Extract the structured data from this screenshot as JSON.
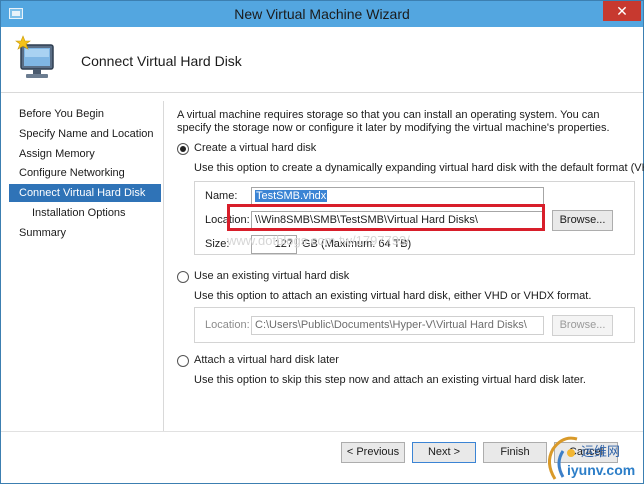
{
  "window": {
    "title": "New Virtual Machine Wizard",
    "close_glyph": "✕"
  },
  "header": {
    "title": "Connect Virtual Hard Disk",
    "icon": "monitor-with-star-icon"
  },
  "sidebar": {
    "items": [
      {
        "label": "Before You Begin",
        "active": false
      },
      {
        "label": "Specify Name and Location",
        "active": false
      },
      {
        "label": "Assign Memory",
        "active": false
      },
      {
        "label": "Configure Networking",
        "active": false
      },
      {
        "label": "Connect Virtual Hard Disk",
        "active": true
      },
      {
        "label": "Installation Options",
        "active": false
      },
      {
        "label": "Summary",
        "active": false
      }
    ]
  },
  "main": {
    "description": "A virtual machine requires storage so that you can install an operating system. You can specify the storage now or configure it later by modifying the virtual machine's properties.",
    "create": {
      "label": "Create a virtual hard disk",
      "checked": true,
      "help": "Use this option to create a dynamically expanding virtual hard disk with the default format (VHDX).",
      "name_label": "Name:",
      "name_value": "TestSMB.vhdx",
      "location_label": "Location:",
      "location_value": "\\\\Win8SMB\\SMB\\TestSMB\\Virtual Hard Disks\\",
      "browse_label": "Browse...",
      "size_label": "Size:",
      "size_value": "127",
      "size_unit": "GB (Maximum: 64 TB)"
    },
    "existing": {
      "label": "Use an existing virtual hard disk",
      "checked": false,
      "help": "Use this option to attach an existing virtual hard disk, either VHD or VHDX format.",
      "location_label": "Location:",
      "location_value": "C:\\Users\\Public\\Documents\\Hyper-V\\Virtual Hard Disks\\",
      "browse_label": "Browse..."
    },
    "later": {
      "label": "Attach a virtual hard disk later",
      "checked": false,
      "help": "Use this option to skip this step now and attach an existing virtual hard disk later."
    }
  },
  "watermark": "www.dotblogs.com.tw/1797793/",
  "footer": {
    "previous_label": "< Previous",
    "next_label": "Next >",
    "finish_label": "Finish",
    "cancel_label": "Cancel"
  },
  "logo": {
    "top_text": "运维网",
    "bottom_text": "iyunv.com"
  },
  "colors": {
    "titlebar": "#53a6e0",
    "active_nav": "#2f73b7",
    "highlight": "#d81e2a",
    "close_button": "#c7392f"
  }
}
